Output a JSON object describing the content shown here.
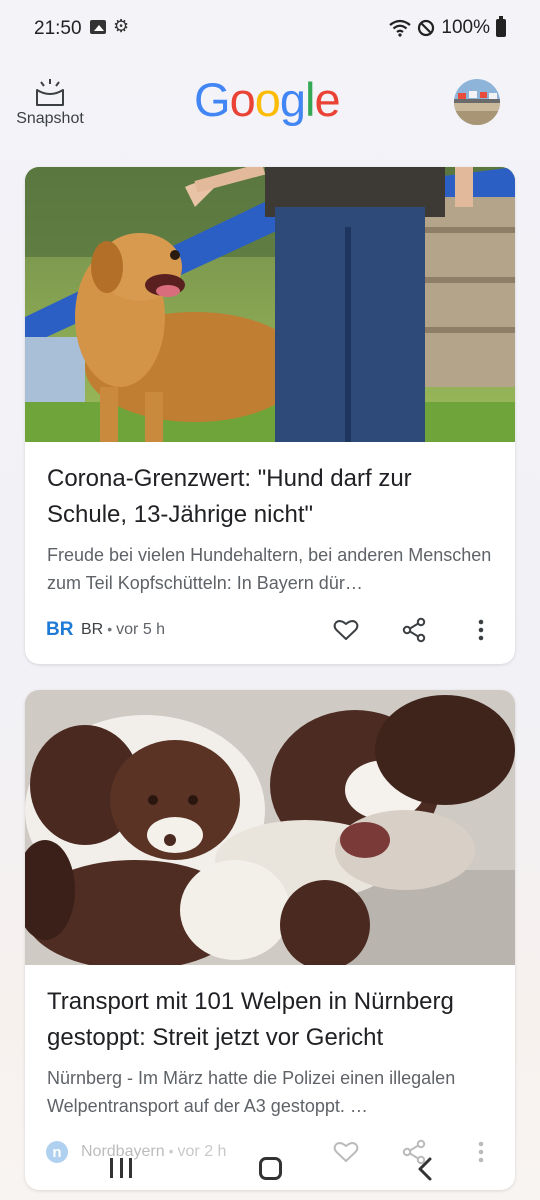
{
  "status_bar": {
    "time": "21:50",
    "battery": "100%",
    "icons": [
      "gallery-icon",
      "gear-icon",
      "wifi-icon",
      "do-not-disturb-icon",
      "battery-icon"
    ]
  },
  "header": {
    "snapshot_label": "Snapshot",
    "logo_letters": [
      "G",
      "o",
      "o",
      "g",
      "l",
      "e"
    ],
    "logo_colors": [
      "#4285F4",
      "#EA4335",
      "#FBBC05",
      "#4285F4",
      "#34A853",
      "#EA4335"
    ]
  },
  "cards": [
    {
      "title": "Corona-Grenzwert: \"Hund darf zur Schule, 13-Jährige nicht\"",
      "snippet": "Freude bei vielen Hundehaltern, bei anderen Menschen zum Teil Kopfschütteln: In Bayern dür…",
      "source_logo": "BR",
      "source": "BR",
      "time": "vor 5 h",
      "accent": "#1a73e8"
    },
    {
      "title": "Transport mit 101 Welpen in Nürnberg gestoppt: Streit jetzt vor Gericht",
      "snippet": "Nürnberg - Im März hatte die Polizei einen illegalen Welpentransport auf der A3 gestoppt. …",
      "source_logo": "n",
      "source": "Nordbayern",
      "time": "vor 2 h",
      "accent": "#1a73e8"
    }
  ],
  "nav_bar": {
    "icons": [
      "recents-icon",
      "home-icon",
      "back-icon"
    ]
  }
}
